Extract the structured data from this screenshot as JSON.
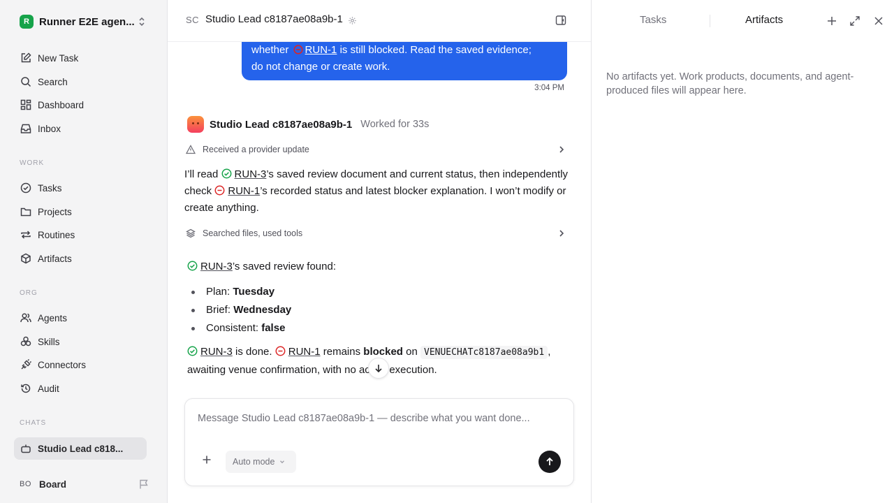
{
  "workspace": {
    "logo_letter": "R",
    "name": "Runner E2E agen..."
  },
  "sidebar": {
    "top": [
      {
        "label": "New Task",
        "icon": "edit-icon"
      },
      {
        "label": "Search",
        "icon": "search-icon"
      },
      {
        "label": "Dashboard",
        "icon": "dashboard-icon"
      },
      {
        "label": "Inbox",
        "icon": "inbox-icon"
      }
    ],
    "work_label": "WORK",
    "work": [
      {
        "label": "Tasks",
        "icon": "check-circle-icon"
      },
      {
        "label": "Projects",
        "icon": "folder-icon"
      },
      {
        "label": "Routines",
        "icon": "repeat-icon"
      },
      {
        "label": "Artifacts",
        "icon": "box-icon"
      }
    ],
    "org_label": "ORG",
    "org": [
      {
        "label": "Agents",
        "icon": "users-icon"
      },
      {
        "label": "Skills",
        "icon": "skills-icon"
      },
      {
        "label": "Connectors",
        "icon": "plug-icon"
      },
      {
        "label": "Audit",
        "icon": "history-icon"
      }
    ],
    "chats_label": "CHATS",
    "chats": [
      {
        "label": "Studio Lead c818...",
        "icon": "bot-icon"
      }
    ],
    "board": {
      "initials": "BO",
      "label": "Board"
    }
  },
  "chat": {
    "header": {
      "initials": "SC",
      "title": "Studio Lead c8187ae08a9b-1"
    },
    "user_message": {
      "line1_prefix": "whether",
      "ref": "RUN-1",
      "line1_suffix": "is still blocked. Read the saved evidence;",
      "line2": "do not change or create work.",
      "time": "3:04 PM"
    },
    "agent": {
      "name": "Studio Lead c8187ae08a9b-1",
      "worked": "Worked for 33s"
    },
    "tool1": "Received a provider update",
    "para1": {
      "t1": "I’ll read",
      "ref1": "RUN-3",
      "t2": "’s saved review document and current status, then independently check",
      "ref2": "RUN-1",
      "t3": "’s recorded status and latest blocker explanation. I won’t modify or create anything."
    },
    "tool2": "Searched files, used tools",
    "review": {
      "ref": "RUN-3",
      "text": "’s saved review found:"
    },
    "bullets": [
      {
        "label": "Plan:",
        "value": "Tuesday"
      },
      {
        "label": "Brief:",
        "value": "Wednesday"
      },
      {
        "label": "Consistent:",
        "value": "false"
      }
    ],
    "summary": {
      "ref1": "RUN-3",
      "t1": "is done.",
      "ref2": "RUN-1",
      "t2": "remains",
      "bold": "blocked",
      "t3": "on",
      "code": "VENUECHATc8187ae08a9b1",
      "t4": ", awaiting venue confirmation, with no active execution."
    },
    "composer": {
      "placeholder": "Message Studio Lead c8187ae08a9b-1 — describe what you want done...",
      "mode": "Auto mode"
    }
  },
  "right_panel": {
    "tabs": [
      "Tasks",
      "Artifacts"
    ],
    "active_tab": "Artifacts",
    "empty_message": "No artifacts yet. Work products, documents, and agent-produced files will appear here."
  },
  "colors": {
    "accent": "#2563eb",
    "success": "#16a34a",
    "blocked": "#dc2626"
  }
}
